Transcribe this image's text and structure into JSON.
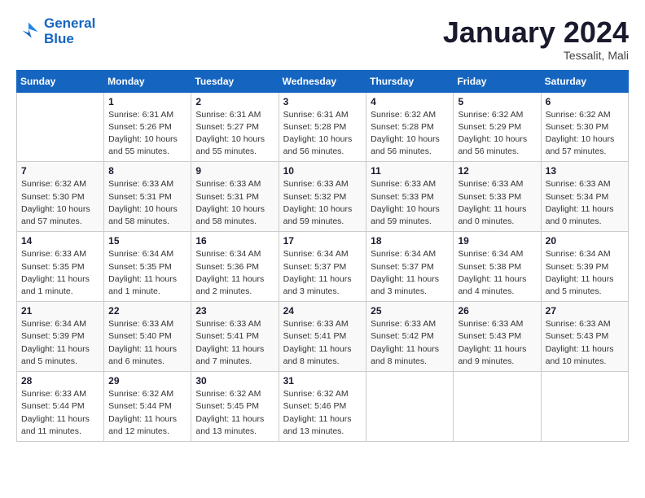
{
  "logo": {
    "line1": "General",
    "line2": "Blue"
  },
  "title": "January 2024",
  "location": "Tessalit, Mali",
  "days_header": [
    "Sunday",
    "Monday",
    "Tuesday",
    "Wednesday",
    "Thursday",
    "Friday",
    "Saturday"
  ],
  "weeks": [
    [
      {
        "day": "",
        "info": ""
      },
      {
        "day": "1",
        "info": "Sunrise: 6:31 AM\nSunset: 5:26 PM\nDaylight: 10 hours\nand 55 minutes."
      },
      {
        "day": "2",
        "info": "Sunrise: 6:31 AM\nSunset: 5:27 PM\nDaylight: 10 hours\nand 55 minutes."
      },
      {
        "day": "3",
        "info": "Sunrise: 6:31 AM\nSunset: 5:28 PM\nDaylight: 10 hours\nand 56 minutes."
      },
      {
        "day": "4",
        "info": "Sunrise: 6:32 AM\nSunset: 5:28 PM\nDaylight: 10 hours\nand 56 minutes."
      },
      {
        "day": "5",
        "info": "Sunrise: 6:32 AM\nSunset: 5:29 PM\nDaylight: 10 hours\nand 56 minutes."
      },
      {
        "day": "6",
        "info": "Sunrise: 6:32 AM\nSunset: 5:30 PM\nDaylight: 10 hours\nand 57 minutes."
      }
    ],
    [
      {
        "day": "7",
        "info": "Sunrise: 6:32 AM\nSunset: 5:30 PM\nDaylight: 10 hours\nand 57 minutes."
      },
      {
        "day": "8",
        "info": "Sunrise: 6:33 AM\nSunset: 5:31 PM\nDaylight: 10 hours\nand 58 minutes."
      },
      {
        "day": "9",
        "info": "Sunrise: 6:33 AM\nSunset: 5:31 PM\nDaylight: 10 hours\nand 58 minutes."
      },
      {
        "day": "10",
        "info": "Sunrise: 6:33 AM\nSunset: 5:32 PM\nDaylight: 10 hours\nand 59 minutes."
      },
      {
        "day": "11",
        "info": "Sunrise: 6:33 AM\nSunset: 5:33 PM\nDaylight: 10 hours\nand 59 minutes."
      },
      {
        "day": "12",
        "info": "Sunrise: 6:33 AM\nSunset: 5:33 PM\nDaylight: 11 hours\nand 0 minutes."
      },
      {
        "day": "13",
        "info": "Sunrise: 6:33 AM\nSunset: 5:34 PM\nDaylight: 11 hours\nand 0 minutes."
      }
    ],
    [
      {
        "day": "14",
        "info": "Sunrise: 6:33 AM\nSunset: 5:35 PM\nDaylight: 11 hours\nand 1 minute."
      },
      {
        "day": "15",
        "info": "Sunrise: 6:34 AM\nSunset: 5:35 PM\nDaylight: 11 hours\nand 1 minute."
      },
      {
        "day": "16",
        "info": "Sunrise: 6:34 AM\nSunset: 5:36 PM\nDaylight: 11 hours\nand 2 minutes."
      },
      {
        "day": "17",
        "info": "Sunrise: 6:34 AM\nSunset: 5:37 PM\nDaylight: 11 hours\nand 3 minutes."
      },
      {
        "day": "18",
        "info": "Sunrise: 6:34 AM\nSunset: 5:37 PM\nDaylight: 11 hours\nand 3 minutes."
      },
      {
        "day": "19",
        "info": "Sunrise: 6:34 AM\nSunset: 5:38 PM\nDaylight: 11 hours\nand 4 minutes."
      },
      {
        "day": "20",
        "info": "Sunrise: 6:34 AM\nSunset: 5:39 PM\nDaylight: 11 hours\nand 5 minutes."
      }
    ],
    [
      {
        "day": "21",
        "info": "Sunrise: 6:34 AM\nSunset: 5:39 PM\nDaylight: 11 hours\nand 5 minutes."
      },
      {
        "day": "22",
        "info": "Sunrise: 6:33 AM\nSunset: 5:40 PM\nDaylight: 11 hours\nand 6 minutes."
      },
      {
        "day": "23",
        "info": "Sunrise: 6:33 AM\nSunset: 5:41 PM\nDaylight: 11 hours\nand 7 minutes."
      },
      {
        "day": "24",
        "info": "Sunrise: 6:33 AM\nSunset: 5:41 PM\nDaylight: 11 hours\nand 8 minutes."
      },
      {
        "day": "25",
        "info": "Sunrise: 6:33 AM\nSunset: 5:42 PM\nDaylight: 11 hours\nand 8 minutes."
      },
      {
        "day": "26",
        "info": "Sunrise: 6:33 AM\nSunset: 5:43 PM\nDaylight: 11 hours\nand 9 minutes."
      },
      {
        "day": "27",
        "info": "Sunrise: 6:33 AM\nSunset: 5:43 PM\nDaylight: 11 hours\nand 10 minutes."
      }
    ],
    [
      {
        "day": "28",
        "info": "Sunrise: 6:33 AM\nSunset: 5:44 PM\nDaylight: 11 hours\nand 11 minutes."
      },
      {
        "day": "29",
        "info": "Sunrise: 6:32 AM\nSunset: 5:44 PM\nDaylight: 11 hours\nand 12 minutes."
      },
      {
        "day": "30",
        "info": "Sunrise: 6:32 AM\nSunset: 5:45 PM\nDaylight: 11 hours\nand 13 minutes."
      },
      {
        "day": "31",
        "info": "Sunrise: 6:32 AM\nSunset: 5:46 PM\nDaylight: 11 hours\nand 13 minutes."
      },
      {
        "day": "",
        "info": ""
      },
      {
        "day": "",
        "info": ""
      },
      {
        "day": "",
        "info": ""
      }
    ]
  ]
}
